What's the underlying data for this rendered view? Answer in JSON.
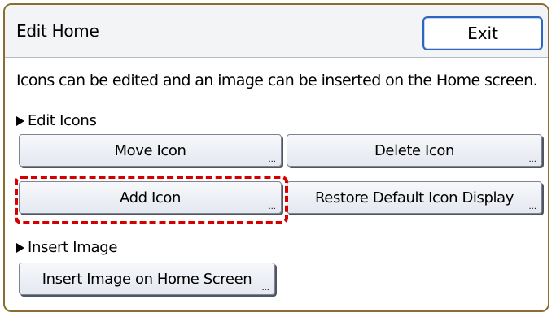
{
  "header": {
    "title": "Edit Home",
    "exit_label": "Exit"
  },
  "description": "Icons can be edited and an image can be inserted on the Home screen.",
  "edit_icons": {
    "heading": "Edit Icons",
    "move_icon_label": "Move Icon",
    "delete_icon_label": "Delete Icon",
    "add_icon_label": "Add Icon",
    "restore_default_label": "Restore Default Icon Display"
  },
  "insert_image": {
    "heading": "Insert Image",
    "insert_on_home_label": "Insert Image on Home Screen"
  },
  "button_more_indicator": "...",
  "colors": {
    "frame_border": "#8a6e2f",
    "exit_border": "#2d65c2",
    "highlight": "#d40000"
  }
}
